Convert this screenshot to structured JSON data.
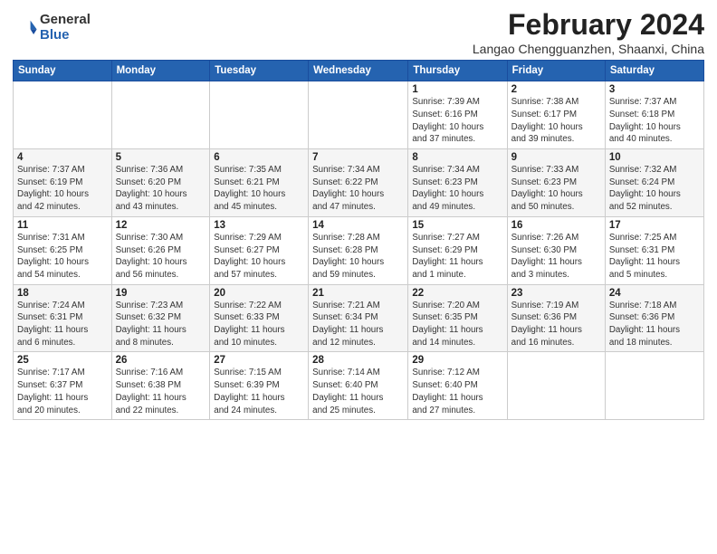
{
  "header": {
    "logo_general": "General",
    "logo_blue": "Blue",
    "month_title": "February 2024",
    "location": "Langao Chengguanzhen, Shaanxi, China"
  },
  "days_of_week": [
    "Sunday",
    "Monday",
    "Tuesday",
    "Wednesday",
    "Thursday",
    "Friday",
    "Saturday"
  ],
  "weeks": [
    [
      {
        "day": "",
        "detail": ""
      },
      {
        "day": "",
        "detail": ""
      },
      {
        "day": "",
        "detail": ""
      },
      {
        "day": "",
        "detail": ""
      },
      {
        "day": "1",
        "detail": "Sunrise: 7:39 AM\nSunset: 6:16 PM\nDaylight: 10 hours\nand 37 minutes."
      },
      {
        "day": "2",
        "detail": "Sunrise: 7:38 AM\nSunset: 6:17 PM\nDaylight: 10 hours\nand 39 minutes."
      },
      {
        "day": "3",
        "detail": "Sunrise: 7:37 AM\nSunset: 6:18 PM\nDaylight: 10 hours\nand 40 minutes."
      }
    ],
    [
      {
        "day": "4",
        "detail": "Sunrise: 7:37 AM\nSunset: 6:19 PM\nDaylight: 10 hours\nand 42 minutes."
      },
      {
        "day": "5",
        "detail": "Sunrise: 7:36 AM\nSunset: 6:20 PM\nDaylight: 10 hours\nand 43 minutes."
      },
      {
        "day": "6",
        "detail": "Sunrise: 7:35 AM\nSunset: 6:21 PM\nDaylight: 10 hours\nand 45 minutes."
      },
      {
        "day": "7",
        "detail": "Sunrise: 7:34 AM\nSunset: 6:22 PM\nDaylight: 10 hours\nand 47 minutes."
      },
      {
        "day": "8",
        "detail": "Sunrise: 7:34 AM\nSunset: 6:23 PM\nDaylight: 10 hours\nand 49 minutes."
      },
      {
        "day": "9",
        "detail": "Sunrise: 7:33 AM\nSunset: 6:23 PM\nDaylight: 10 hours\nand 50 minutes."
      },
      {
        "day": "10",
        "detail": "Sunrise: 7:32 AM\nSunset: 6:24 PM\nDaylight: 10 hours\nand 52 minutes."
      }
    ],
    [
      {
        "day": "11",
        "detail": "Sunrise: 7:31 AM\nSunset: 6:25 PM\nDaylight: 10 hours\nand 54 minutes."
      },
      {
        "day": "12",
        "detail": "Sunrise: 7:30 AM\nSunset: 6:26 PM\nDaylight: 10 hours\nand 56 minutes."
      },
      {
        "day": "13",
        "detail": "Sunrise: 7:29 AM\nSunset: 6:27 PM\nDaylight: 10 hours\nand 57 minutes."
      },
      {
        "day": "14",
        "detail": "Sunrise: 7:28 AM\nSunset: 6:28 PM\nDaylight: 10 hours\nand 59 minutes."
      },
      {
        "day": "15",
        "detail": "Sunrise: 7:27 AM\nSunset: 6:29 PM\nDaylight: 11 hours\nand 1 minute."
      },
      {
        "day": "16",
        "detail": "Sunrise: 7:26 AM\nSunset: 6:30 PM\nDaylight: 11 hours\nand 3 minutes."
      },
      {
        "day": "17",
        "detail": "Sunrise: 7:25 AM\nSunset: 6:31 PM\nDaylight: 11 hours\nand 5 minutes."
      }
    ],
    [
      {
        "day": "18",
        "detail": "Sunrise: 7:24 AM\nSunset: 6:31 PM\nDaylight: 11 hours\nand 6 minutes."
      },
      {
        "day": "19",
        "detail": "Sunrise: 7:23 AM\nSunset: 6:32 PM\nDaylight: 11 hours\nand 8 minutes."
      },
      {
        "day": "20",
        "detail": "Sunrise: 7:22 AM\nSunset: 6:33 PM\nDaylight: 11 hours\nand 10 minutes."
      },
      {
        "day": "21",
        "detail": "Sunrise: 7:21 AM\nSunset: 6:34 PM\nDaylight: 11 hours\nand 12 minutes."
      },
      {
        "day": "22",
        "detail": "Sunrise: 7:20 AM\nSunset: 6:35 PM\nDaylight: 11 hours\nand 14 minutes."
      },
      {
        "day": "23",
        "detail": "Sunrise: 7:19 AM\nSunset: 6:36 PM\nDaylight: 11 hours\nand 16 minutes."
      },
      {
        "day": "24",
        "detail": "Sunrise: 7:18 AM\nSunset: 6:36 PM\nDaylight: 11 hours\nand 18 minutes."
      }
    ],
    [
      {
        "day": "25",
        "detail": "Sunrise: 7:17 AM\nSunset: 6:37 PM\nDaylight: 11 hours\nand 20 minutes."
      },
      {
        "day": "26",
        "detail": "Sunrise: 7:16 AM\nSunset: 6:38 PM\nDaylight: 11 hours\nand 22 minutes."
      },
      {
        "day": "27",
        "detail": "Sunrise: 7:15 AM\nSunset: 6:39 PM\nDaylight: 11 hours\nand 24 minutes."
      },
      {
        "day": "28",
        "detail": "Sunrise: 7:14 AM\nSunset: 6:40 PM\nDaylight: 11 hours\nand 25 minutes."
      },
      {
        "day": "29",
        "detail": "Sunrise: 7:12 AM\nSunset: 6:40 PM\nDaylight: 11 hours\nand 27 minutes."
      },
      {
        "day": "",
        "detail": ""
      },
      {
        "day": "",
        "detail": ""
      }
    ]
  ]
}
